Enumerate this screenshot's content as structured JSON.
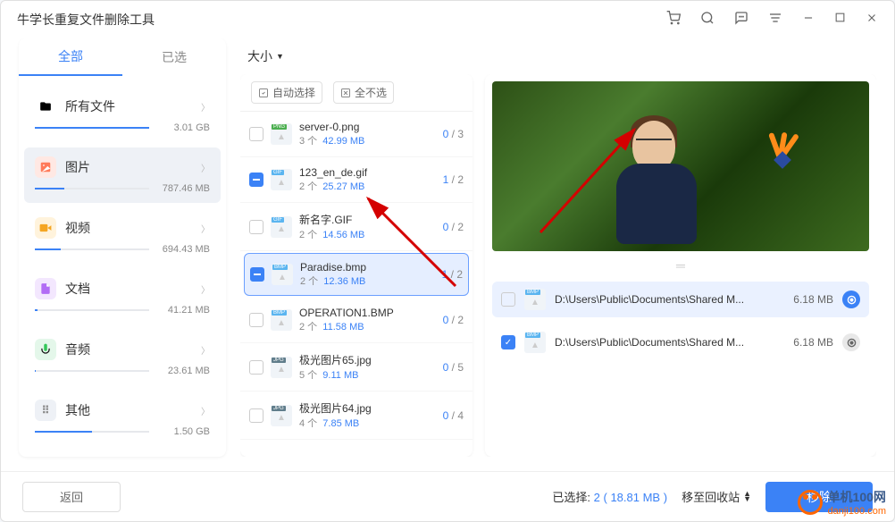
{
  "app_title": "牛学长重复文件删除工具",
  "tabs": {
    "all": "全部",
    "selected": "已选"
  },
  "categories": [
    {
      "id": "all",
      "label": "所有文件",
      "size": "3.01 GB",
      "fill": 100
    },
    {
      "id": "pic",
      "label": "图片",
      "size": "787.46 MB",
      "fill": 26
    },
    {
      "id": "vid",
      "label": "视频",
      "size": "694.43 MB",
      "fill": 23
    },
    {
      "id": "doc",
      "label": "文档",
      "size": "41.21 MB",
      "fill": 2
    },
    {
      "id": "aud",
      "label": "音频",
      "size": "23.61 MB",
      "fill": 1
    },
    {
      "id": "other",
      "label": "其他",
      "size": "1.50 GB",
      "fill": 50
    }
  ],
  "sort_label": "大小",
  "toolbar": {
    "auto_select": "自动选择",
    "deselect_all": "全不选"
  },
  "files": [
    {
      "name": "server-0.png",
      "ext": "PNG",
      "count": "3 个",
      "size": "42.99 MB",
      "sel": "0",
      "total": "3",
      "check": "none"
    },
    {
      "name": "123_en_de.gif",
      "ext": "GIF",
      "count": "2 个",
      "size": "25.27 MB",
      "sel": "1",
      "total": "2",
      "check": "minus"
    },
    {
      "name": "新名字.GIF",
      "ext": "GIF",
      "count": "2 个",
      "size": "14.56 MB",
      "sel": "0",
      "total": "2",
      "check": "none"
    },
    {
      "name": "Paradise.bmp",
      "ext": "BMP",
      "count": "2 个",
      "size": "12.36 MB",
      "sel": "1",
      "total": "2",
      "check": "minus",
      "selected": true
    },
    {
      "name": "OPERATION1.BMP",
      "ext": "BMP",
      "count": "2 个",
      "size": "11.58 MB",
      "sel": "0",
      "total": "2",
      "check": "none"
    },
    {
      "name": "极光图片65.jpg",
      "ext": "JPG",
      "count": "5 个",
      "size": "9.11 MB",
      "sel": "0",
      "total": "5",
      "check": "none"
    },
    {
      "name": "极光图片64.jpg",
      "ext": "JPG",
      "count": "4 个",
      "size": "7.85 MB",
      "sel": "0",
      "total": "4",
      "check": "none"
    }
  ],
  "paths": [
    {
      "path": "D:\\Users\\Public\\Documents\\Shared M...",
      "size": "6.18 MB",
      "checked": false,
      "ext": "BMP",
      "highlighted": true
    },
    {
      "path": "D:\\Users\\Public\\Documents\\Shared M...",
      "size": "6.18 MB",
      "checked": true,
      "ext": "BMP",
      "highlighted": false
    }
  ],
  "footer": {
    "back": "返回",
    "selected_label": "已选择:",
    "selected_count": "2",
    "selected_size": "18.81 MB",
    "move_recycle": "移至回收站",
    "remove": "移除"
  },
  "watermark": {
    "line1": "单机100网",
    "line2": "danji100.com"
  }
}
